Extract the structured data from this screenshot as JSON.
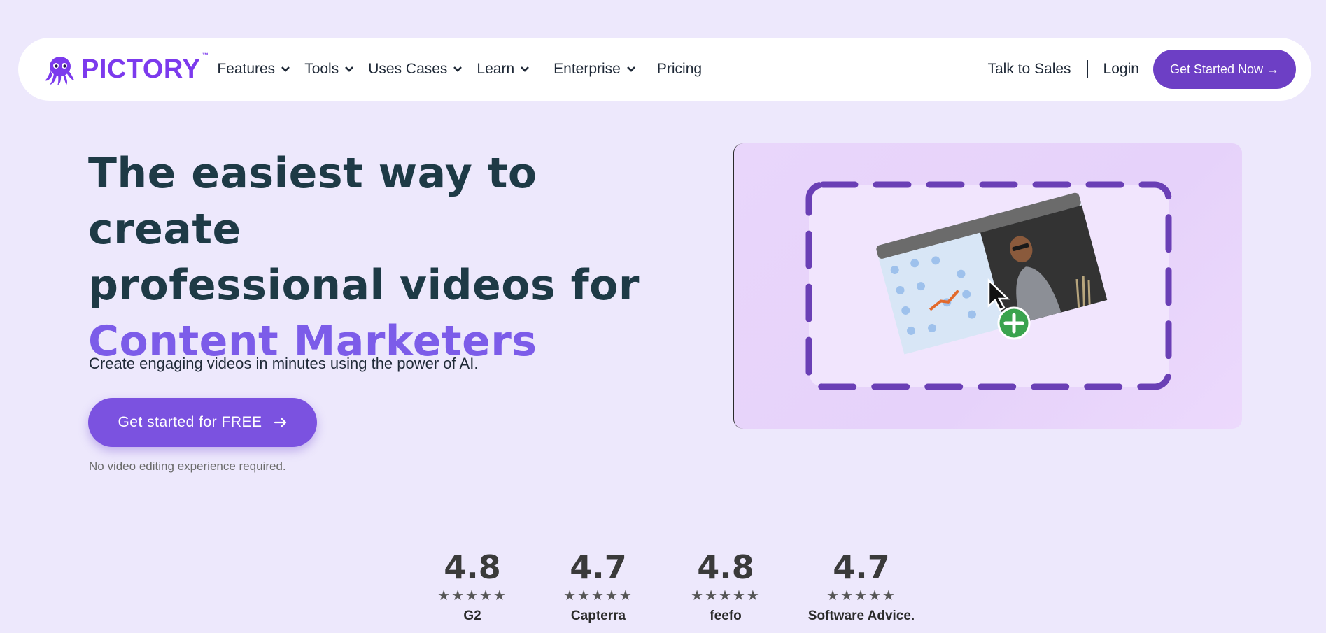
{
  "nav": {
    "logo_text": "PICTORY",
    "logo_tm": "™",
    "items": [
      {
        "label": "Features"
      },
      {
        "label": "Tools"
      },
      {
        "label": "Uses Cases"
      },
      {
        "label": "Learn"
      },
      {
        "label": "Enterprise"
      }
    ],
    "pricing": "Pricing",
    "talk_to_sales": "Talk to Sales",
    "login": "Login",
    "cta": "Get Started Now →"
  },
  "hero": {
    "title_line1": "The easiest way to create",
    "title_line2": "professional videos for",
    "title_accent": "Content Marketers",
    "subtitle": "Create engaging videos in minutes using the power of AI.",
    "cta": "Get started for FREE",
    "note": "No video editing experience required."
  },
  "ratings": [
    {
      "score": "4.8",
      "stars": "★★★★★",
      "brand": "G2"
    },
    {
      "score": "4.7",
      "stars": "★★★★★",
      "brand": "Capterra"
    },
    {
      "score": "4.8",
      "stars": "★★★★★",
      "brand": "feefo"
    },
    {
      "score": "4.7",
      "stars": "★★★★★",
      "brand": "Software Advice."
    }
  ],
  "colors": {
    "background": "#ede8fc",
    "brand_purple": "#6d3fc5",
    "accent_text": "#7c5ce9",
    "heading": "#1e3a46"
  },
  "icons": {
    "logo": "octopus-logo-icon",
    "chevron": "chevron-down-icon",
    "arrow": "arrow-right-icon",
    "cursor": "mouse-cursor-icon",
    "plus": "plus-circle-icon"
  }
}
